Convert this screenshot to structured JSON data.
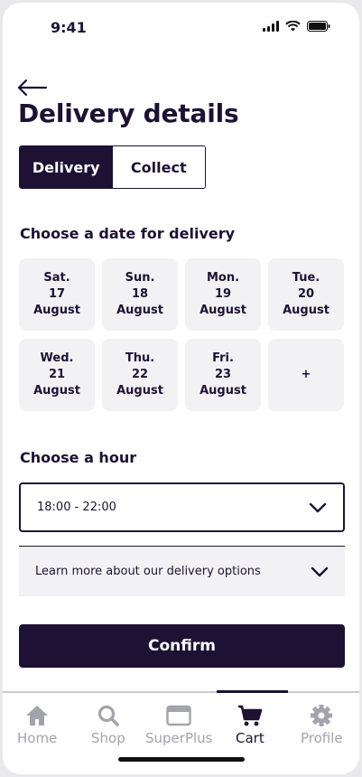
{
  "status": {
    "time": "9:41"
  },
  "header": {
    "title": "Delivery details"
  },
  "toggle": {
    "delivery": "Delivery",
    "collect": "Collect"
  },
  "date_section": {
    "label": "Choose a date for delivery",
    "dates": [
      {
        "day": "Sat.",
        "num": "17",
        "month": "August"
      },
      {
        "day": "Sun.",
        "num": "18",
        "month": "August"
      },
      {
        "day": "Mon.",
        "num": "19",
        "month": "August"
      },
      {
        "day": "Tue.",
        "num": "20",
        "month": "August"
      },
      {
        "day": "Wed.",
        "num": "21",
        "month": "August"
      },
      {
        "day": "Thu.",
        "num": "22",
        "month": "August"
      },
      {
        "day": "Fri.",
        "num": "23",
        "month": "August"
      }
    ],
    "more": "+"
  },
  "hour_section": {
    "label": "Choose a hour",
    "selected": "18:00 - 22:00"
  },
  "info": {
    "text": "Learn more about our delivery options"
  },
  "confirm": {
    "label": "Confirm"
  },
  "tabs": [
    {
      "label": "Home",
      "icon": "home-icon"
    },
    {
      "label": "Shop",
      "icon": "search-icon"
    },
    {
      "label": "SuperPlus",
      "icon": "card-icon"
    },
    {
      "label": "Cart",
      "icon": "cart-icon"
    },
    {
      "label": "Profile",
      "icon": "gear-icon"
    }
  ],
  "colors": {
    "primary": "#1d1233",
    "tile": "#f2f2f5",
    "inactive": "#a3a3ab"
  }
}
